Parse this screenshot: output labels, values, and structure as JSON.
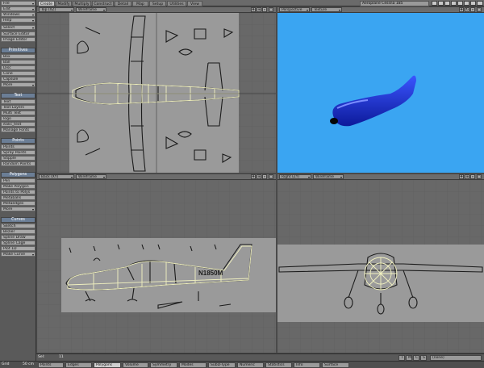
{
  "tabs": [
    "Create",
    "Modify",
    "Multiply",
    "Construct",
    "Detail",
    "Map",
    "Setup",
    "Utilities",
    "View"
  ],
  "active_tab": "Create",
  "scene_name": "Aeroplane Cessna 185",
  "sidebar": {
    "top": [
      "File",
      "Edit",
      "Windows",
      "Help",
      "Select",
      "Surface Editor",
      "Image Editor"
    ],
    "primitives": {
      "header": "Primitives",
      "items": [
        "Box",
        "Ball",
        "Disc",
        "Cone",
        "Capsule",
        "More"
      ]
    },
    "text": {
      "header": "Text",
      "items": [
        "Text",
        "Text Layers",
        "Multi Text",
        "logo",
        "italic_text",
        "Manage Fonts"
      ]
    },
    "points": {
      "header": "Points",
      "items": [
        "Points",
        "Spray Points",
        "Stipple",
        "Random Points"
      ]
    },
    "polygons": {
      "header": "Polygons",
      "items": [
        "Pen",
        "Make Polygon",
        "Points to Polys",
        "Metaballs",
        "Metaedges",
        "More"
      ]
    },
    "curves": {
      "header": "Curves",
      "items": [
        "Sketch",
        "Bezier",
        "Spline Draw",
        "Spline Cage",
        "Plot 1D",
        "Make Curve"
      ]
    }
  },
  "viewports": {
    "tl": {
      "view": "Top",
      "axis": "(XZ)",
      "mode": "Wireframe"
    },
    "tr": {
      "view": "Perspective",
      "mode": "Texture"
    },
    "bl": {
      "view": "Back",
      "axis": "(XY)",
      "mode": "Wireframe"
    },
    "br": {
      "view": "Right",
      "axis": "(ZY)",
      "mode": "Wireframe"
    }
  },
  "status": {
    "label": "Sel:",
    "value": "11",
    "flags": [
      "T",
      "M",
      "C",
      "S"
    ],
    "none_label": "(none)"
  },
  "bottom": {
    "grid_label": "Grid",
    "grid_value": "50 cm",
    "buttons": [
      "Points",
      "Edges",
      "Polygons",
      "Volume",
      "Symmetry",
      "Modes",
      "SubD-Type",
      "Numeric",
      "Statistics",
      "Info",
      "Surface"
    ],
    "active": "Polygons"
  },
  "colors": {
    "sky": "#3aa5f2",
    "plane": "#1c2fd2",
    "wire": "#f0f0c0",
    "sidebar_header": "#6b7e96"
  }
}
